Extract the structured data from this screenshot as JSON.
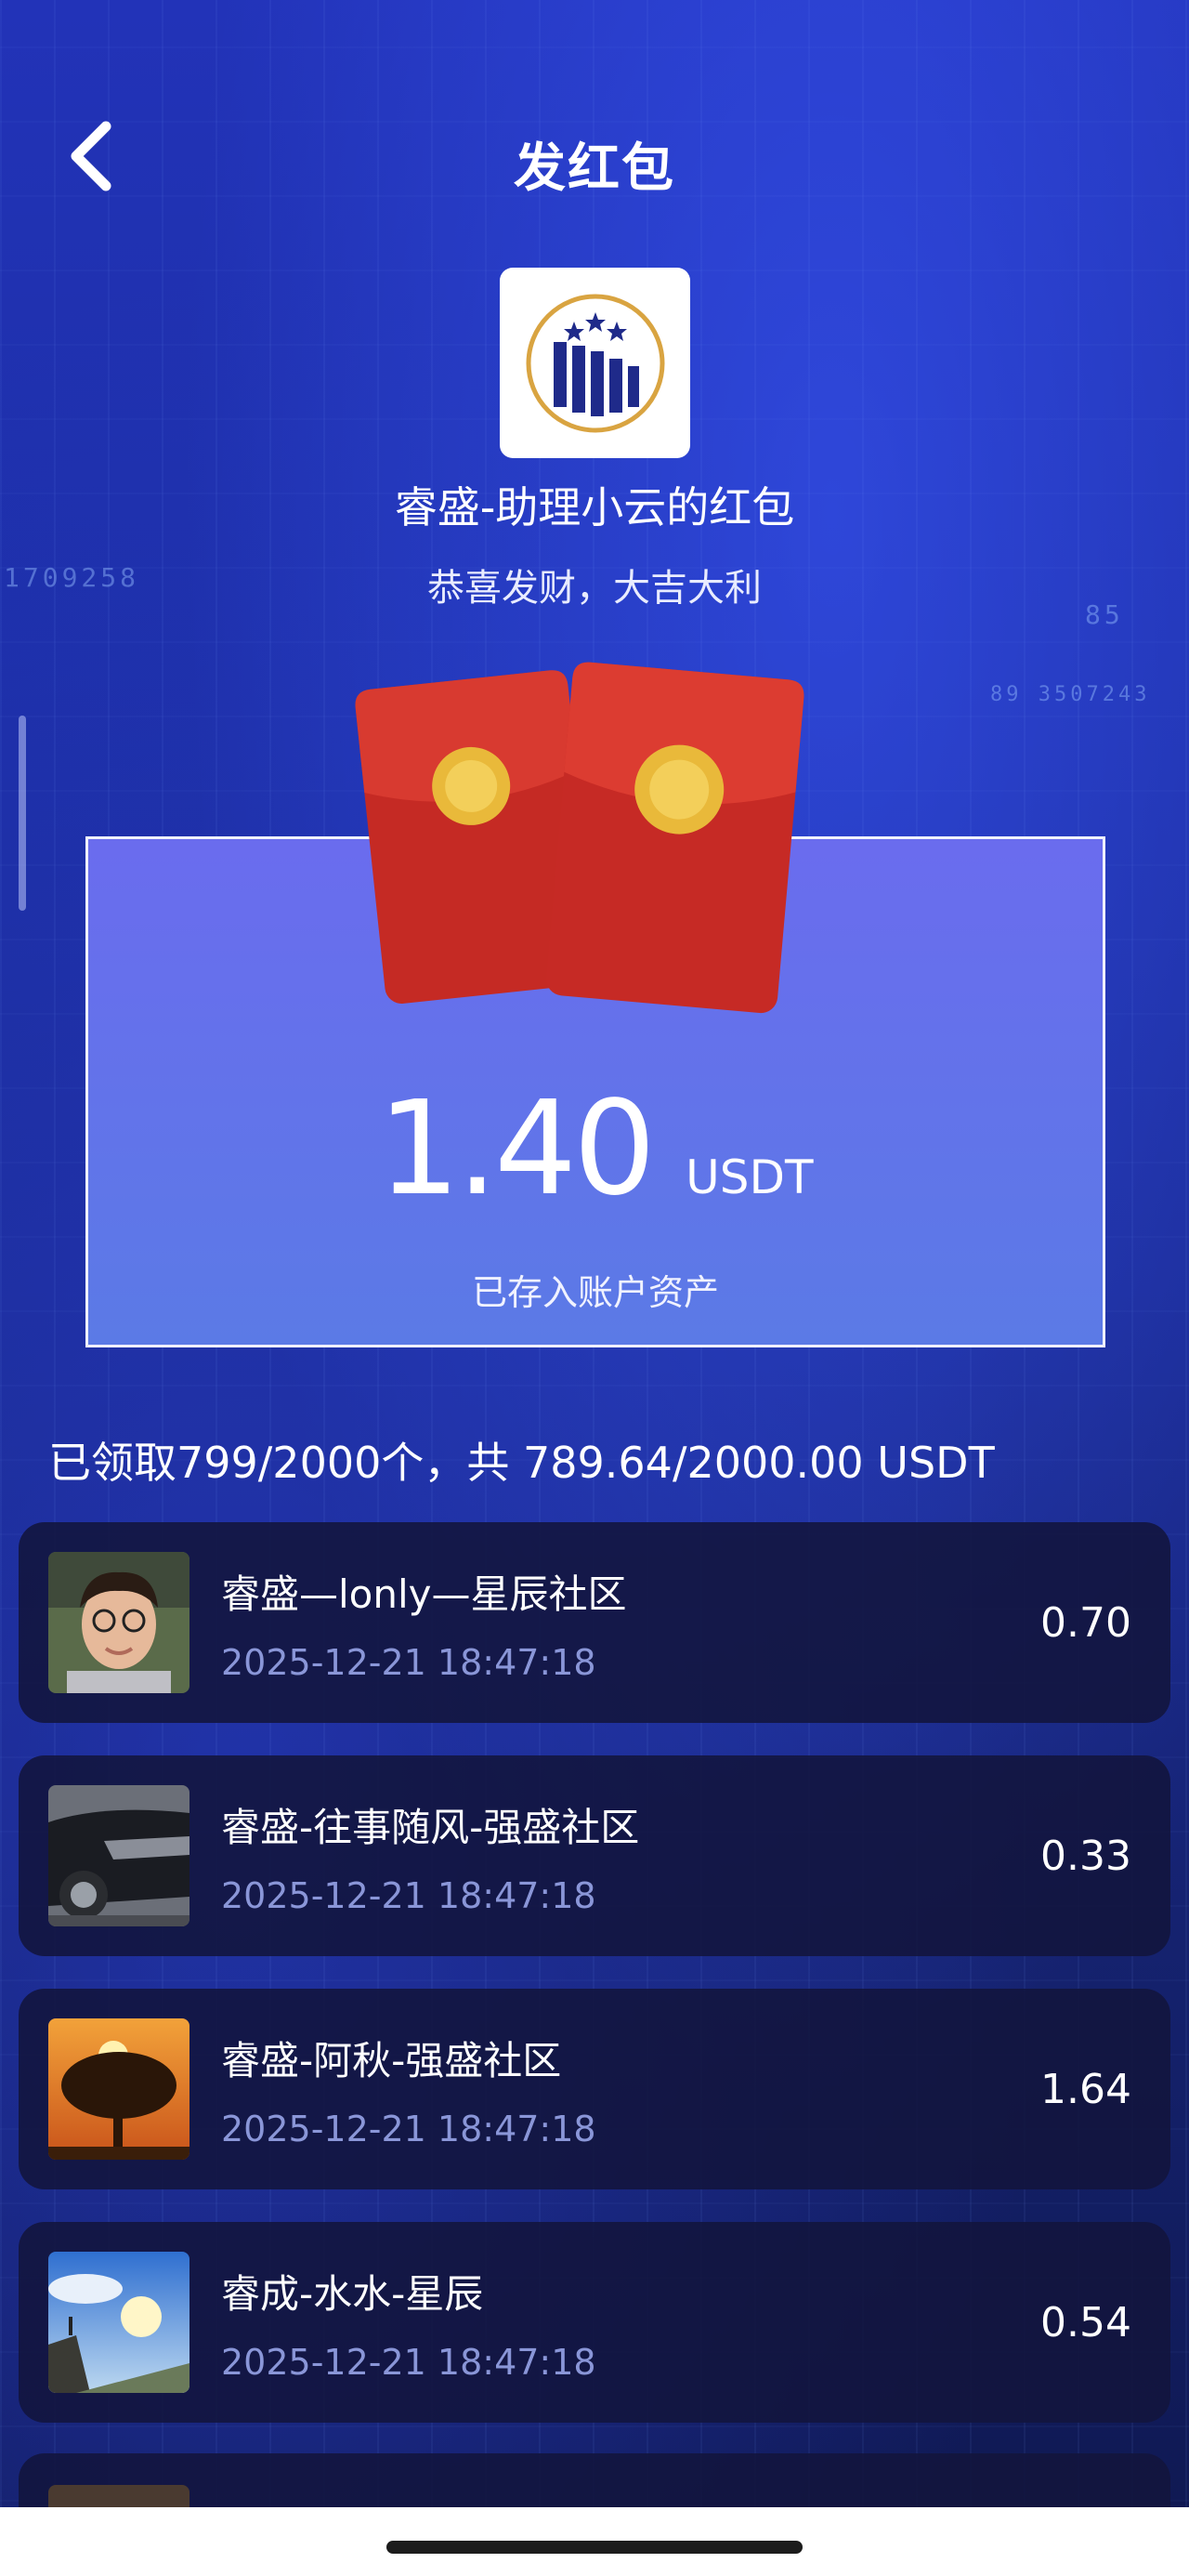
{
  "header": {
    "title": "发红包"
  },
  "sender": {
    "name": "睿盛-助理小云的红包",
    "blessing": "恭喜发财，大吉大利"
  },
  "amount": {
    "value": "1.40",
    "unit": "USDT",
    "note": "已存入账户资产"
  },
  "summary": "已领取799/2000个，共 789.64/2000.00 USDT",
  "background_numbers": [
    "1709258",
    "85",
    "89 3507243"
  ],
  "records": [
    {
      "name": "睿盛—lonly—星辰社区",
      "time": "2025-12-21 18:47:18",
      "amount": "0.70",
      "avatar": "person-photo"
    },
    {
      "name": "睿盛-往事随风-强盛社区",
      "time": "2025-12-21 18:47:18",
      "amount": "0.33",
      "avatar": "car-photo"
    },
    {
      "name": "睿盛-阿秋-强盛社区",
      "time": "2025-12-21 18:47:18",
      "amount": "1.64",
      "avatar": "sunset-tree-photo"
    },
    {
      "name": "睿成-水水-星辰",
      "time": "2025-12-21 18:47:18",
      "amount": "0.54",
      "avatar": "mountain-sky-photo"
    }
  ],
  "colors": {
    "card_top": "#6a6cee",
    "card_bottom": "#5b7ae6",
    "time_text": "#8a96d8",
    "envelope_red": "#d0302a",
    "coin_gold": "#e9b93a"
  }
}
